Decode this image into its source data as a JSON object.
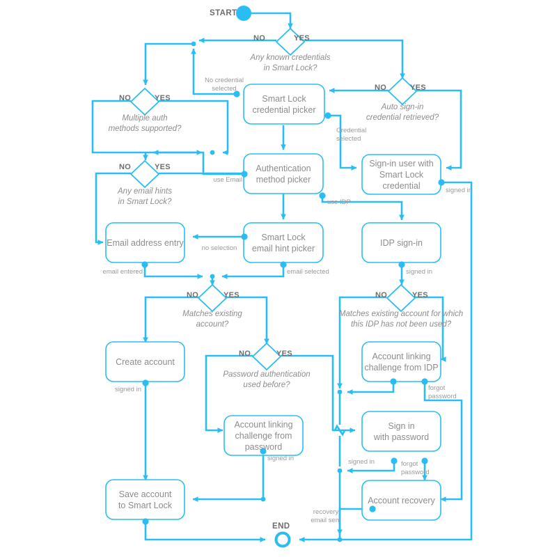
{
  "theme": {
    "accent": "#29bdf4",
    "node_text": "#8d8d8d",
    "label_text": "#9a9a9a",
    "yesno_text": "#6d6d6d",
    "background": "#ffffff"
  },
  "terminals": {
    "start": "START",
    "end": "END"
  },
  "nodes": [
    {
      "id": "smart-lock-credential-picker",
      "label": "Smart Lock\ncredential picker"
    },
    {
      "id": "sign-in-user-with-smart-lock-credential",
      "label": "Sign-in user with\nSmart Lock credential"
    },
    {
      "id": "authentication-method-picker",
      "label": "Authentication\nmethod picker"
    },
    {
      "id": "email-address-entry",
      "label": "Email address entry"
    },
    {
      "id": "smart-lock-email-hint-picker",
      "label": "Smart Lock\nemail hint picker"
    },
    {
      "id": "idp-sign-in",
      "label": "IDP sign-in"
    },
    {
      "id": "create-account",
      "label": "Create account"
    },
    {
      "id": "account-linking-challenge-from-idp",
      "label": "Account linking\nchallenge from IDP"
    },
    {
      "id": "account-linking-challenge-from-password",
      "label": "Account linking\nchallenge from\npassword"
    },
    {
      "id": "sign-in-with-password",
      "label": "Sign in\nwith password"
    },
    {
      "id": "account-recovery",
      "label": "Account recovery"
    },
    {
      "id": "save-account-to-smart-lock",
      "label": "Save account\nto Smart Lock"
    }
  ],
  "decisions": [
    {
      "id": "any-known-credentials",
      "question": "Any known credentials\nin Smart Lock?",
      "no": "NO",
      "yes": "YES"
    },
    {
      "id": "auto-sign-in-credential-retrieved",
      "question": "Auto sign-in\ncredential retrieved?",
      "no": "NO",
      "yes": "YES"
    },
    {
      "id": "multiple-auth-methods-supported",
      "question": "Multiple auth\nmethods supported?",
      "no": "NO",
      "yes": "YES"
    },
    {
      "id": "any-email-hints",
      "question": "Any email hints\nin Smart Lock?",
      "no": "NO",
      "yes": "YES"
    },
    {
      "id": "matches-existing-account",
      "question": "Matches existing\naccount?",
      "no": "NO",
      "yes": "YES"
    },
    {
      "id": "matches-existing-account-idp",
      "question": "Matches existing account for which\nthis IDP has not been used?",
      "no": "NO",
      "yes": "YES"
    },
    {
      "id": "password-authentication-used-before",
      "question": "Password authentication\nused before?",
      "no": "NO",
      "yes": "YES"
    }
  ],
  "edge_labels": [
    {
      "id": "no-credential-selected",
      "text": "No credential\nselected"
    },
    {
      "id": "credential-selected",
      "text": "Credential\nselected"
    },
    {
      "id": "signed-in-smartlock",
      "text": "signed in"
    },
    {
      "id": "use-email",
      "text": "use Email"
    },
    {
      "id": "use-idp",
      "text": "use IDP"
    },
    {
      "id": "no-selection",
      "text": "no selection"
    },
    {
      "id": "email-entered",
      "text": "email entered"
    },
    {
      "id": "email-selected",
      "text": "email selected"
    },
    {
      "id": "signed-in-idp",
      "text": "signed in"
    },
    {
      "id": "signed-in-create-account",
      "text": "signed in"
    },
    {
      "id": "forgot-password-idp",
      "text": "forgot\npassword"
    },
    {
      "id": "signed-in-linking-password",
      "text": "signed in"
    },
    {
      "id": "signed-in-password",
      "text": "signed in"
    },
    {
      "id": "forgot-password-signin",
      "text": "forgot\npassword"
    },
    {
      "id": "recovery-email-sent",
      "text": "recovery\nemail sent"
    }
  ]
}
